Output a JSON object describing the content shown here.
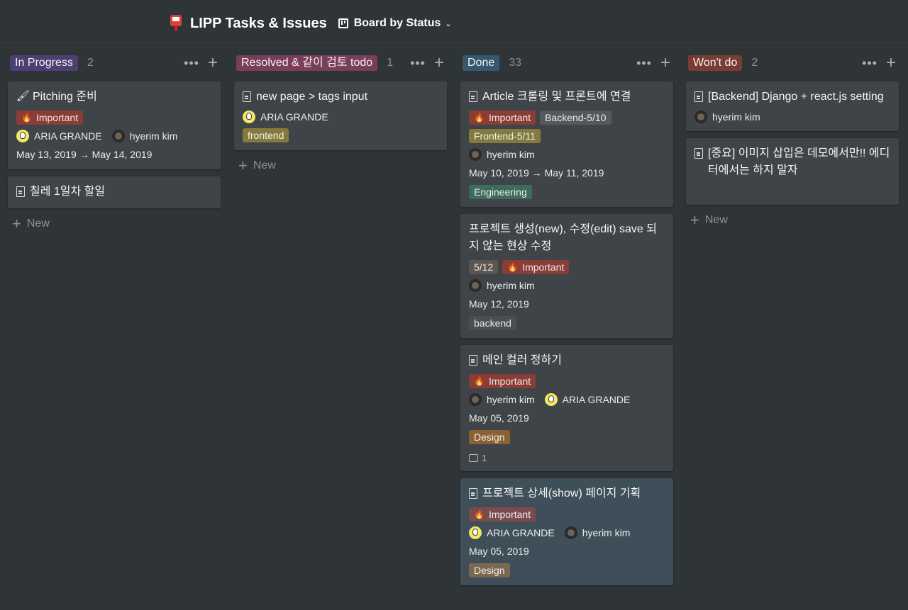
{
  "page": {
    "title": "LIPP Tasks & Issues",
    "page_icon": "pushpin-icon",
    "view_name": "Board by Status"
  },
  "colors": {
    "background": "#2f3437",
    "card": "#3f4448",
    "card_highlight": "#3e4f5a"
  },
  "columns": [
    {
      "label": "In Progress",
      "count": "2",
      "color": "#4c3f72",
      "cards": [
        {
          "title": "Pitching 준비",
          "icon": "paintbrush-icon",
          "tags": [
            {
              "label": "Important",
              "fire": true,
              "color": "#8a3c36"
            }
          ],
          "people": [
            {
              "name": "ARIA GRANDE",
              "avatar": "aria"
            },
            {
              "name": "hyerim kim",
              "avatar": "hyerim"
            }
          ],
          "date": "May 13, 2019 → May 14, 2019"
        },
        {
          "title": "칠레 1일차 할일",
          "icon": "document-icon"
        }
      ],
      "new_label": "New"
    },
    {
      "label": "Resolved & 같이 검토 todo",
      "count": "1",
      "color": "#7a3d5c",
      "cards": [
        {
          "title": "new page > tags input",
          "icon": "document-icon",
          "people": [
            {
              "name": "ARIA GRANDE",
              "avatar": "aria"
            }
          ],
          "tags2": [
            {
              "label": "frontend",
              "color": "#857a3e"
            }
          ]
        }
      ],
      "new_label": "New"
    },
    {
      "label": "Done",
      "count": "33",
      "color": "#36586e",
      "cards": [
        {
          "title": "Article 크롤링 및 프론트에 연결",
          "icon": "document-icon",
          "tags": [
            {
              "label": "Important",
              "fire": true,
              "color": "#8a3c36"
            },
            {
              "label": "Backend-5/10",
              "color": "#55595c"
            },
            {
              "label": "Frontend-5/11",
              "color": "#857a3e"
            }
          ],
          "people": [
            {
              "name": "hyerim kim",
              "avatar": "hyerim"
            }
          ],
          "date": "May 10, 2019 → May 11, 2019",
          "tags2": [
            {
              "label": "Engineering",
              "color": "#3e6b5b"
            }
          ]
        },
        {
          "title": "프로젝트 생성(new), 수정(edit) save 되지 않는 현상 수정",
          "icon": "",
          "tags": [
            {
              "label": "5/12",
              "color": "#5d5650"
            },
            {
              "label": "Important",
              "fire": true,
              "color": "#8a3c36"
            }
          ],
          "people": [
            {
              "name": "hyerim kim",
              "avatar": "hyerim"
            }
          ],
          "date": "May 12, 2019",
          "tags2": [
            {
              "label": "backend",
              "color": "#4a4f53"
            }
          ]
        },
        {
          "title": "메인 컬러 정하기",
          "icon": "document-icon",
          "tags": [
            {
              "label": "Important",
              "fire": true,
              "color": "#8a3c36"
            }
          ],
          "people": [
            {
              "name": "hyerim kim",
              "avatar": "hyerim"
            },
            {
              "name": "ARIA GRANDE",
              "avatar": "aria"
            }
          ],
          "date": "May 05, 2019",
          "tags2": [
            {
              "label": "Design",
              "color": "#8a6134"
            }
          ],
          "comments": "1"
        },
        {
          "title": "프로젝트 상세(show) 페이지 기획",
          "icon": "document-icon",
          "highlight": true,
          "tags": [
            {
              "label": "Important",
              "fire": true,
              "color": "#7a4a4c"
            }
          ],
          "people": [
            {
              "name": "ARIA GRANDE",
              "avatar": "aria"
            },
            {
              "name": "hyerim kim",
              "avatar": "hyerim"
            }
          ],
          "date": "May 05, 2019",
          "tags2": [
            {
              "label": "Design",
              "color": "#7a6950"
            }
          ]
        }
      ]
    },
    {
      "label": "Won't do",
      "count": "2",
      "color": "#7a3b35",
      "cards": [
        {
          "title": "[Backend] Django + react.js setting",
          "icon": "document-icon",
          "people": [
            {
              "name": "hyerim kim",
              "avatar": "hyerim"
            }
          ]
        },
        {
          "title": "[중요] 이미지 삽입은 데모에서만!! 에디터에서는 하지 말자",
          "icon": "document-icon",
          "pad_bottom": true
        }
      ],
      "new_label": "New"
    }
  ]
}
